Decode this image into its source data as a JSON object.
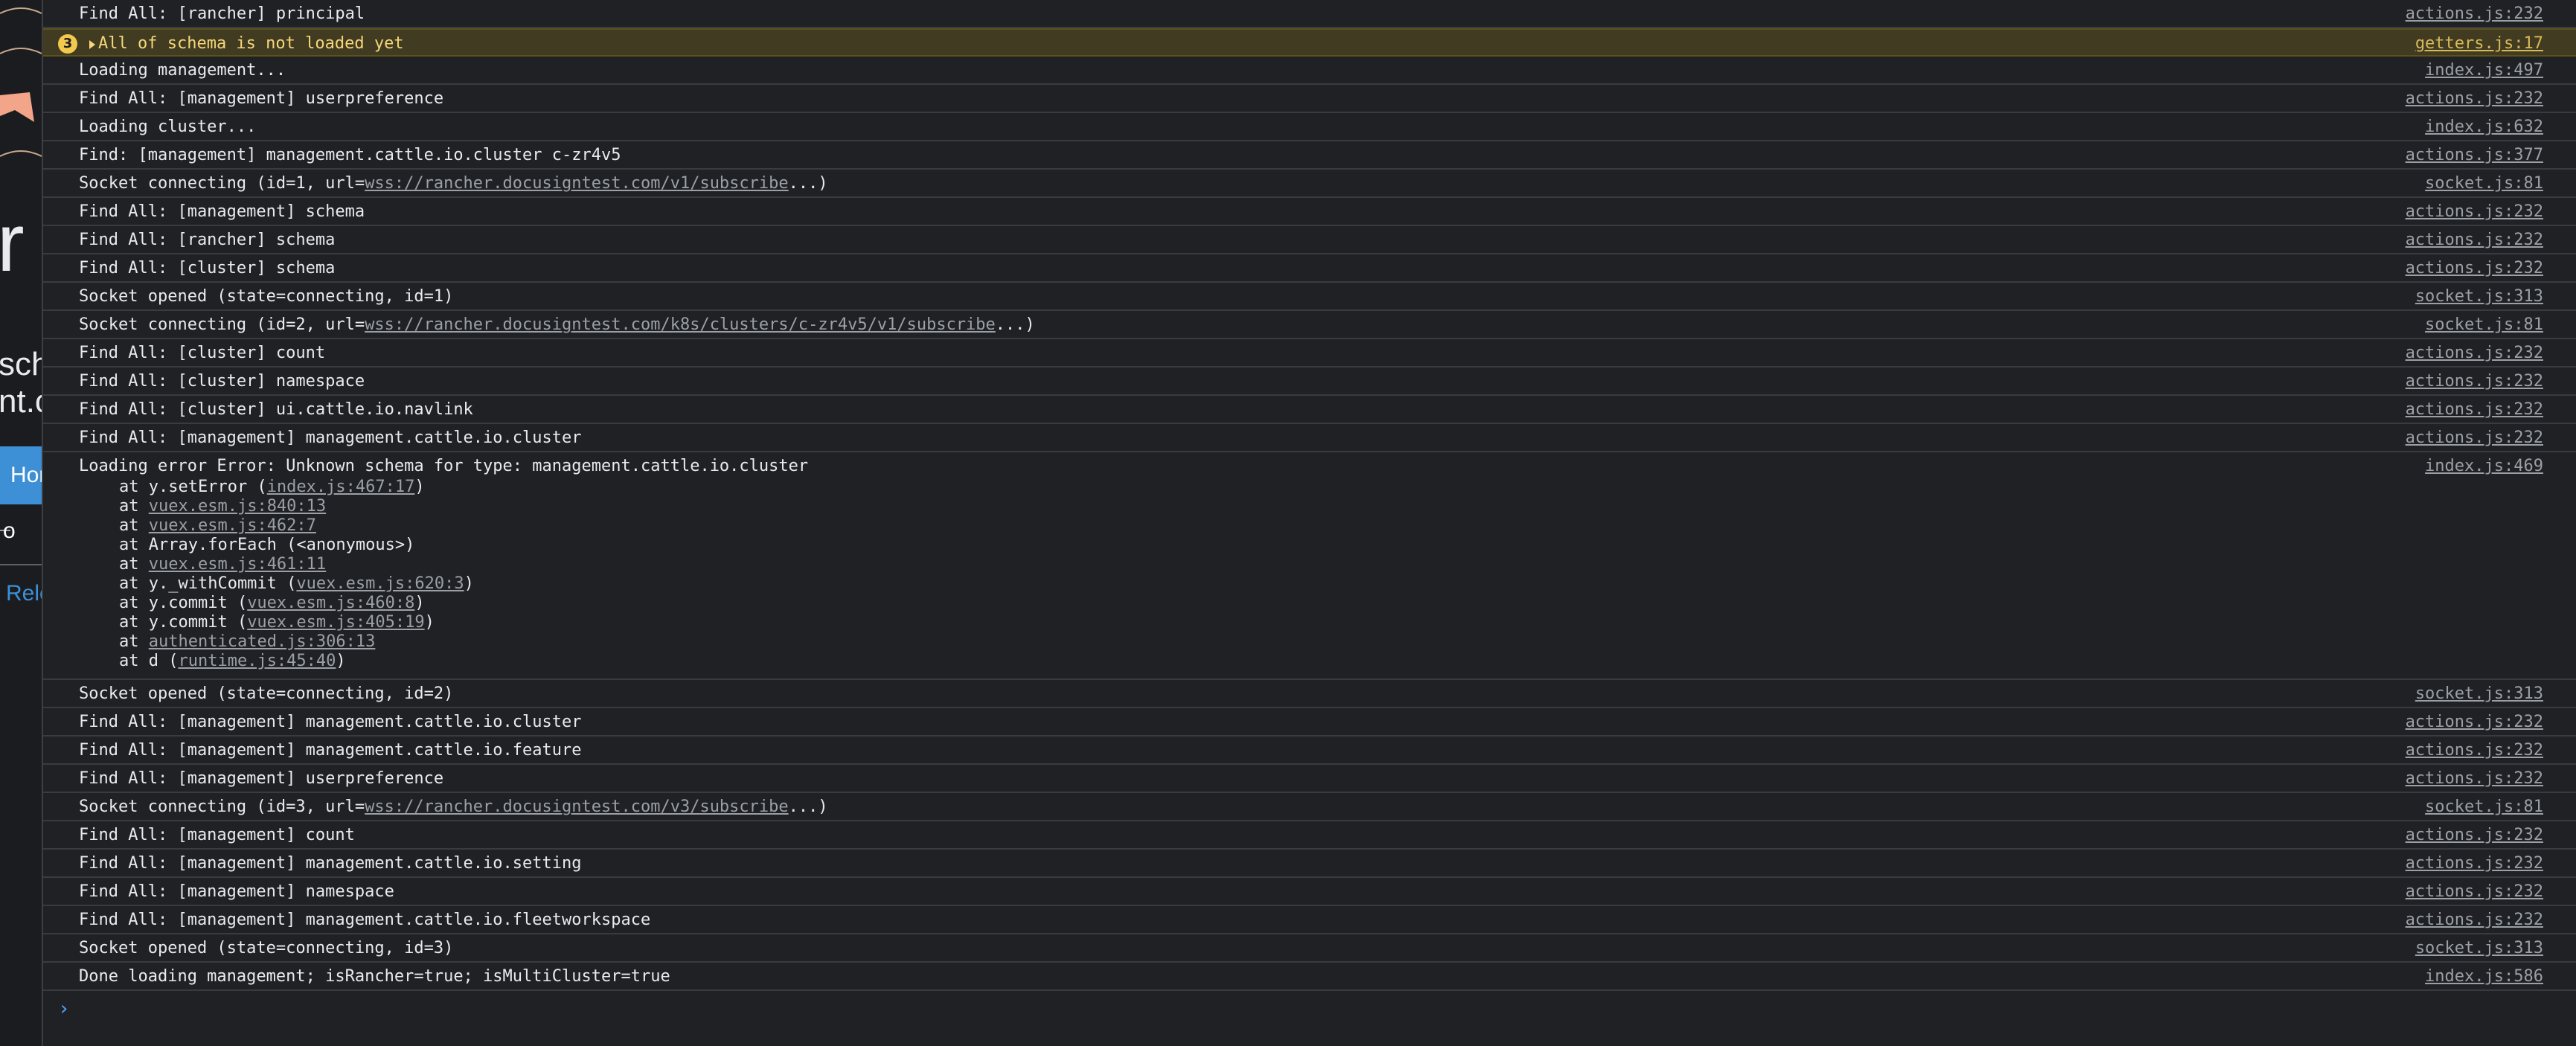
{
  "background_page": {
    "big_text": "r",
    "line1": "sch",
    "line2": "nt.c",
    "home_button": "Hon",
    "item_text": "o",
    "reload_link": "Relo"
  },
  "console": {
    "warning_count": "3",
    "warning_message": "All of schema is not loaded yet",
    "warning_source": "getters.js:17",
    "rows": [
      {
        "message": "Find All: [rancher] principal",
        "source": "actions.js:232"
      },
      {
        "message": "Loading management...",
        "source": "index.js:497"
      },
      {
        "message": "Find All: [management] userpreference",
        "source": "actions.js:232"
      },
      {
        "message": "Loading cluster...",
        "source": "index.js:632"
      },
      {
        "message": "Find: [management] management.cattle.io.cluster c-zr4v5",
        "source": "actions.js:377"
      },
      {
        "message": "Socket connecting (id=1, url=",
        "link": "wss://rancher.docusigntest.com/v1/subscribe",
        "suffix": "...)",
        "source": "socket.js:81"
      },
      {
        "message": "Find All: [management] schema",
        "source": "actions.js:232"
      },
      {
        "message": "Find All: [rancher] schema",
        "source": "actions.js:232"
      },
      {
        "message": "Find All: [cluster] schema",
        "source": "actions.js:232"
      },
      {
        "message": "Socket opened (state=connecting, id=1)",
        "source": "socket.js:313"
      },
      {
        "message": "Socket connecting (id=2, url=",
        "link": "wss://rancher.docusigntest.com/k8s/clusters/c-zr4v5/v1/subscribe",
        "suffix": "...)",
        "source": "socket.js:81"
      },
      {
        "message": "Find All: [cluster] count",
        "source": "actions.js:232"
      },
      {
        "message": "Find All: [cluster] namespace",
        "source": "actions.js:232"
      },
      {
        "message": "Find All: [cluster] ui.cattle.io.navlink",
        "source": "actions.js:232"
      },
      {
        "message": "Find All: [management] management.cattle.io.cluster",
        "source": "actions.js:232"
      }
    ],
    "error": {
      "message": "Loading error Error: Unknown schema for type: management.cattle.io.cluster",
      "source": "index.js:469",
      "stack": [
        {
          "prefix": "at y.setError (",
          "link": "index.js:467:17",
          "suffix": ")"
        },
        {
          "prefix": "at ",
          "link": "vuex.esm.js:840:13",
          "suffix": ""
        },
        {
          "prefix": "at ",
          "link": "vuex.esm.js:462:7",
          "suffix": ""
        },
        {
          "prefix": "at Array.forEach (<anonymous>)",
          "link": "",
          "suffix": ""
        },
        {
          "prefix": "at ",
          "link": "vuex.esm.js:461:11",
          "suffix": ""
        },
        {
          "prefix": "at y._withCommit (",
          "link": "vuex.esm.js:620:3",
          "suffix": ")"
        },
        {
          "prefix": "at y.commit (",
          "link": "vuex.esm.js:460:8",
          "suffix": ")"
        },
        {
          "prefix": "at y.commit (",
          "link": "vuex.esm.js:405:19",
          "suffix": ")"
        },
        {
          "prefix": "at ",
          "link": "authenticated.js:306:13",
          "suffix": ""
        },
        {
          "prefix": "at d (",
          "link": "runtime.js:45:40",
          "suffix": ")"
        }
      ]
    },
    "rows_after": [
      {
        "message": "Socket opened (state=connecting, id=2)",
        "source": "socket.js:313"
      },
      {
        "message": "Find All: [management] management.cattle.io.cluster",
        "source": "actions.js:232"
      },
      {
        "message": "Find All: [management] management.cattle.io.feature",
        "source": "actions.js:232"
      },
      {
        "message": "Find All: [management] userpreference",
        "source": "actions.js:232"
      },
      {
        "message": "Socket connecting (id=3, url=",
        "link": "wss://rancher.docusigntest.com/v3/subscribe",
        "suffix": "...)",
        "source": "socket.js:81"
      },
      {
        "message": "Find All: [management] count",
        "source": "actions.js:232"
      },
      {
        "message": "Find All: [management] management.cattle.io.setting",
        "source": "actions.js:232"
      },
      {
        "message": "Find All: [management] namespace",
        "source": "actions.js:232"
      },
      {
        "message": "Find All: [management] management.cattle.io.fleetworkspace",
        "source": "actions.js:232"
      },
      {
        "message": "Socket opened (state=connecting, id=3)",
        "source": "socket.js:313"
      },
      {
        "message": "Done loading management; isRancher=true; isMultiCluster=true",
        "source": "index.js:586"
      }
    ],
    "prompt_symbol": "›"
  }
}
